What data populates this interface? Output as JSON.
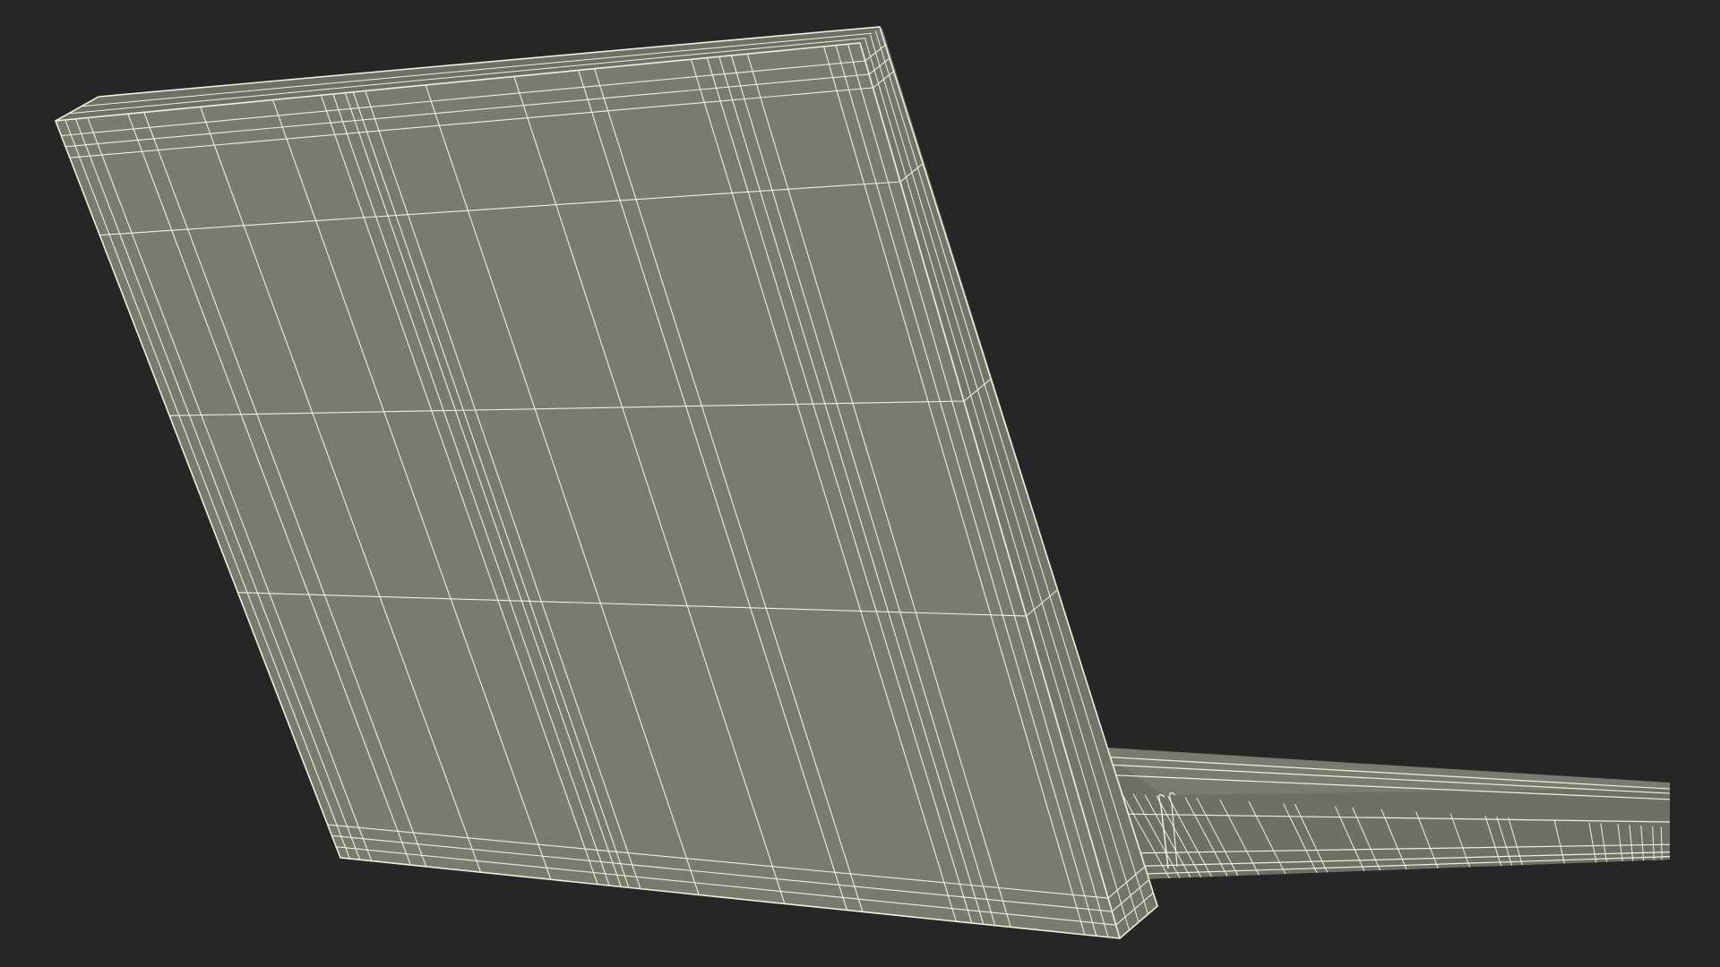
{
  "scene": {
    "subject": "laptop-wireframe-render",
    "colors": {
      "background": "#262626",
      "surface": "#7a7b6f",
      "surface_shade": "#6f7065",
      "wire": "#f2f0dc"
    }
  }
}
